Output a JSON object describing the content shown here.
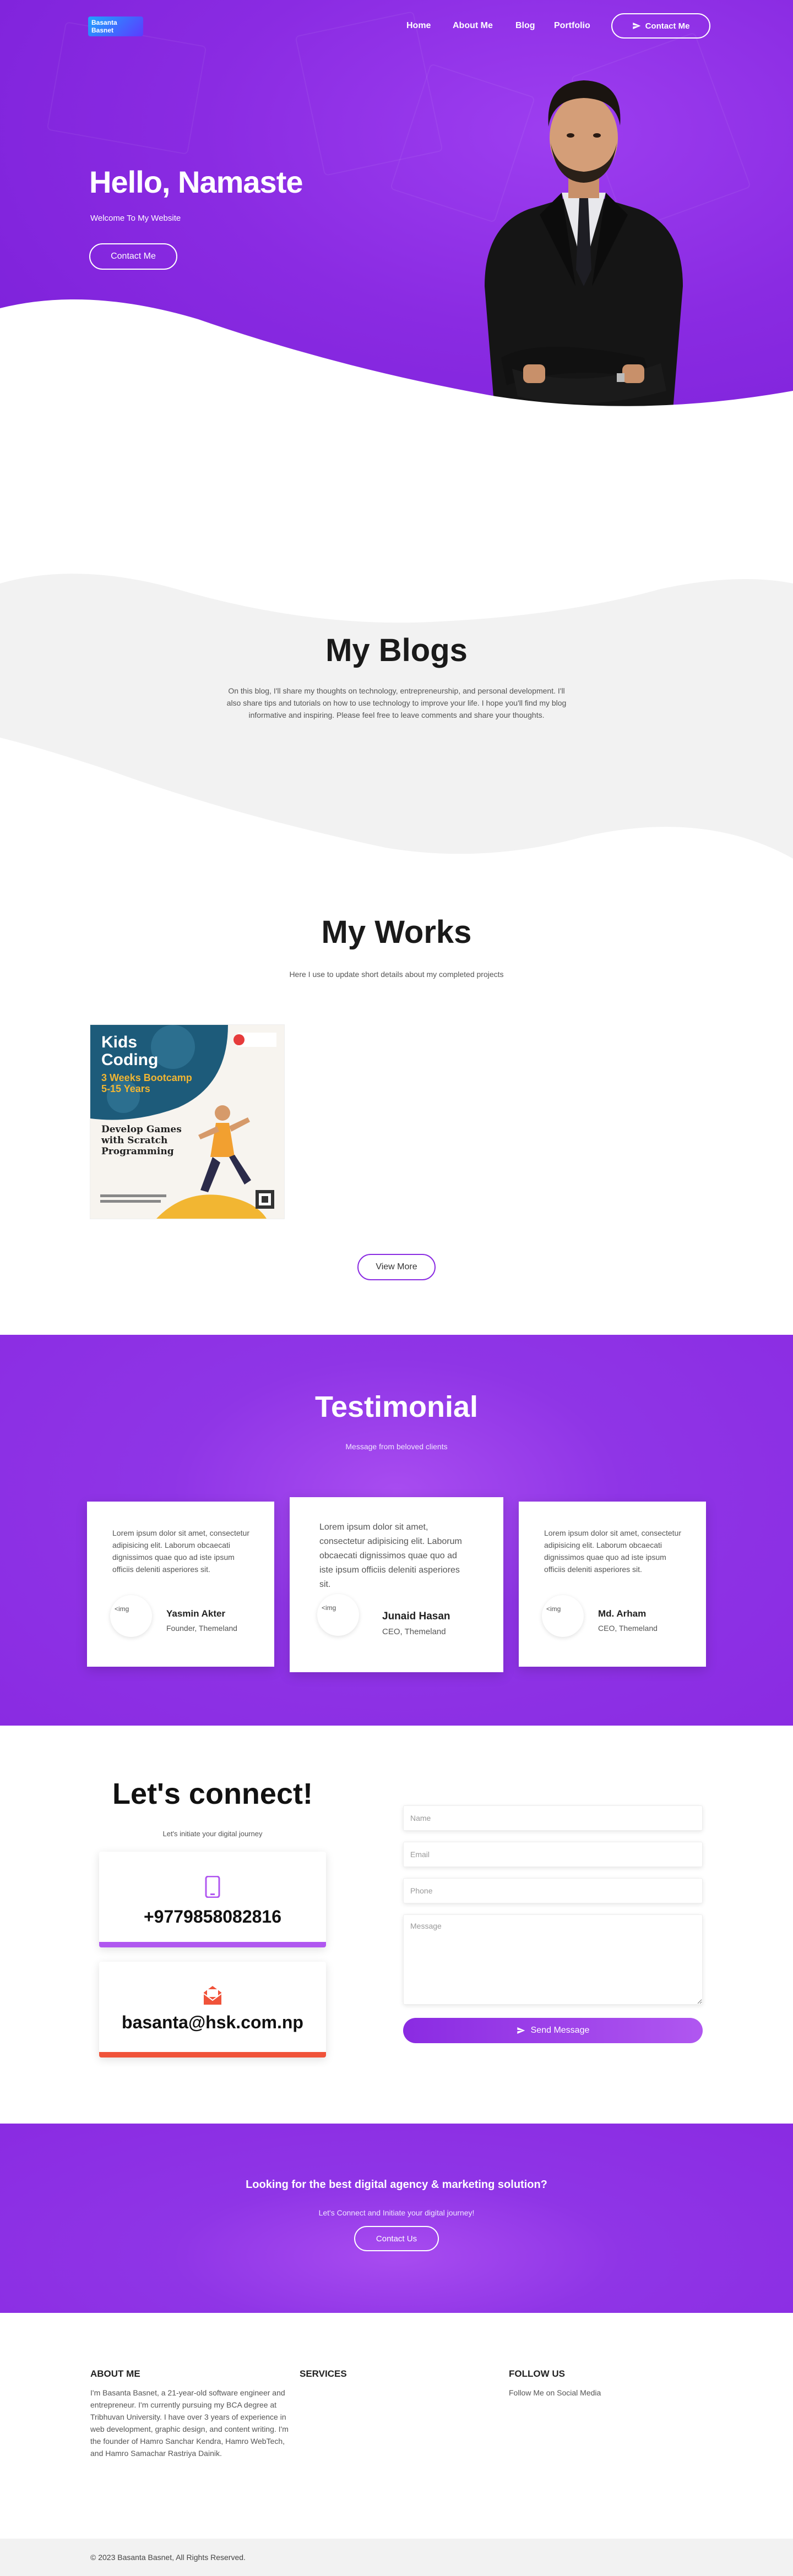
{
  "header": {
    "logo_text_1": "Basanta",
    "logo_text_2": "Basnet",
    "nav": [
      "Home",
      "About Me",
      "Blog",
      "Portfolio"
    ],
    "contact_button": "Contact Me"
  },
  "hero": {
    "title": "Hello, Namaste",
    "subtitle": "Welcome To My Website",
    "button": "Contact Me"
  },
  "blogs": {
    "title": "My Blogs",
    "text": "On this blog, I'll share my thoughts on technology, entrepreneurship, and personal development. I'll also share tips and tutorials on how to use technology to improve your life. I hope you'll find my blog informative and inspiring. Please feel free to leave comments and share your thoughts."
  },
  "works": {
    "title": "My Works",
    "subtitle": "Here I use to update short details about my completed projects",
    "poster": {
      "line1": "Kids",
      "line2": "Coding",
      "line3": "3 Weeks Bootcamp",
      "line4": "5-15 Years",
      "line5": "Develop Games",
      "line6": "with Scratch",
      "line7": "Programming"
    },
    "view_more": "View More"
  },
  "testimonial": {
    "title": "Testimonial",
    "subtitle": "Message from beloved clients",
    "cards": [
      {
        "text": "Lorem ipsum dolor sit amet, consectetur adipisicing elit. Laborum obcaecati dignissimos quae quo ad iste ipsum officiis deleniti asperiores sit.",
        "img_alt": "<img",
        "name": "Yasmin Akter",
        "role": "Founder, Themeland"
      },
      {
        "text": "Lorem ipsum dolor sit amet, consectetur adipisicing elit. Laborum obcaecati dignissimos quae quo ad iste ipsum officiis deleniti asperiores sit.",
        "img_alt": "<img",
        "name": "Junaid Hasan",
        "role": "CEO, Themeland"
      },
      {
        "text": "Lorem ipsum dolor sit amet, consectetur adipisicing elit. Laborum obcaecati dignissimos quae quo ad iste ipsum officiis deleniti asperiores sit.",
        "img_alt": "<img",
        "name": "Md. Arham",
        "role": "CEO, Themeland"
      }
    ]
  },
  "connect": {
    "title": "Let's connect!",
    "subtitle": "Let's initiate your digital journey",
    "phone": "+9779858082816",
    "email": "basanta@hsk.com.np",
    "placeholders": {
      "name": "Name",
      "email": "Email",
      "phone": "Phone",
      "message": "Message"
    },
    "send_button": "Send Message"
  },
  "cta": {
    "title": "Looking for the best digital agency & marketing solution?",
    "subtitle": "Let's Connect and Initiate your digital journey!",
    "button": "Contact Us"
  },
  "footer": {
    "about_title": "ABOUT ME",
    "about_text": "I'm Basanta Basnet, a 21-year-old software engineer and entrepreneur. I'm currently pursuing my BCA degree at Tribhuvan University. I have over 3 years of experience in web development, graphic design, and content writing. I'm the founder of Hamro Sanchar Kendra, Hamro WebTech, and Hamro Samachar Rastriya Dainik.",
    "services_title": "SERVICES",
    "follow_title": "FOLLOW US",
    "follow_text": "Follow Me on Social Media",
    "copyright": "© 2023 Basanta Basnet, All Rights Reserved."
  },
  "colors": {
    "primary": "#8a2be2",
    "accent_phone": "#b057f0",
    "accent_email": "#f0533a"
  }
}
